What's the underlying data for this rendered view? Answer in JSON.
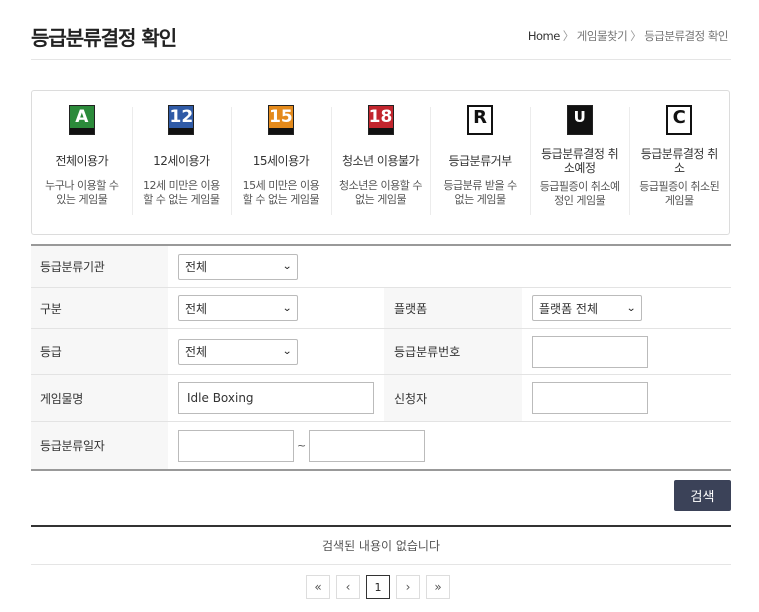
{
  "header": {
    "title": "등급분류결정 확인",
    "breadcrumb": [
      "Home",
      "게임물찾기",
      "등급분류결정 확인"
    ]
  },
  "grades": [
    {
      "icon": "all-ages-rating-icon",
      "badge": "A",
      "color": "#2b8a3a",
      "name": "전체이용가",
      "desc": "누구나 이용할 수 있는 게임물"
    },
    {
      "icon": "age-12-rating-icon",
      "badge": "12",
      "color": "#2f5aa6",
      "name": "12세이용가",
      "desc": "12세 미만은 이용할 수 없는 게임물"
    },
    {
      "icon": "age-15-rating-icon",
      "badge": "15",
      "color": "#e48a1b",
      "name": "15세이용가",
      "desc": "15세 미만은 이용할 수 없는 게임물"
    },
    {
      "icon": "youth-restricted-rating-icon",
      "badge": "18",
      "color": "#c2252d",
      "name": "청소년 이용불가",
      "desc": "청소년은 이용할 수 없는 게임물"
    },
    {
      "icon": "refused-rating-icon",
      "badge": "R",
      "color": "#ffffff",
      "name": "등급분류거부",
      "desc": "등급분류 받을 수 없는 게임물"
    },
    {
      "icon": "cancel-scheduled-rating-icon",
      "badge": "U",
      "color": "#111111",
      "name": "등급분류결정 취소예정",
      "desc": "등급필증이 취소예정인 게임물"
    },
    {
      "icon": "cancelled-rating-icon",
      "badge": "C",
      "color": "#ffffff",
      "name": "등급분류결정 취소",
      "desc": "등급필증이 취소된 게임물"
    }
  ],
  "form": {
    "agency_label": "등급분류기관",
    "agency_value": "전체",
    "type_label": "구분",
    "type_value": "전체",
    "platform_label": "플랫폼",
    "platform_value": "플랫폼 전체",
    "grade_label": "등급",
    "grade_value": "전체",
    "number_label": "등급분류번호",
    "number_value": "",
    "game_label": "게임물명",
    "game_value": "Idle Boxing",
    "applicant_label": "신청자",
    "applicant_value": "",
    "date_label": "등급분류일자",
    "date_from": "",
    "date_sep": "~",
    "date_to": ""
  },
  "search_button": "검색",
  "result_message": "검색된 내용이 없습니다",
  "pagination": {
    "first": "«",
    "prev": "‹",
    "current": "1",
    "next": "›",
    "last": "»"
  },
  "colors": {
    "button_bg": "#3b4258",
    "label_bg": "#f7f7f7"
  }
}
